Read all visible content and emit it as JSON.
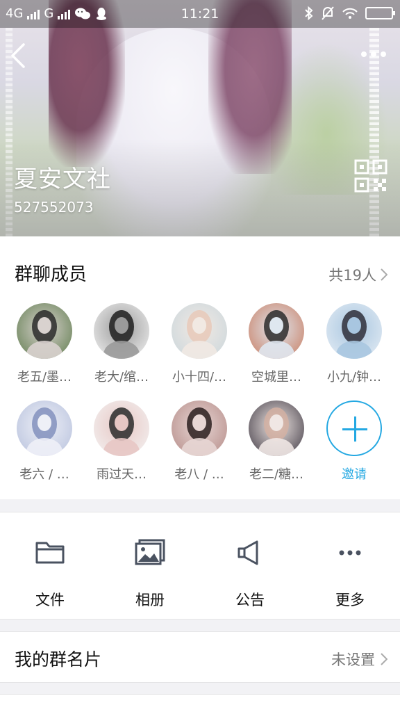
{
  "status_bar": {
    "network_1": "4G",
    "network_2": "G",
    "time": "11:21"
  },
  "header": {
    "group_name": "夏安文社",
    "group_id": "527552073"
  },
  "members": {
    "title": "群聊成员",
    "count_label": "共19人",
    "items": [
      {
        "label": "老五/墨…",
        "colors": [
          "#5c7a4a",
          "#2a2a2a",
          "#d9d2cf"
        ]
      },
      {
        "label": "老大/绾…",
        "colors": [
          "#f5f5f5",
          "#1d1d1d",
          "#9a9a9a"
        ]
      },
      {
        "label": "小十四/…",
        "colors": [
          "#c9d6dc",
          "#e8c9b8",
          "#f1e9e3"
        ]
      },
      {
        "label": "空城里…",
        "colors": [
          "#c87a5e",
          "#2b2b2b",
          "#dfe7ef"
        ]
      },
      {
        "label": "小九/钟…",
        "colors": [
          "#e7eef5",
          "#2f2f39",
          "#a8c6e0"
        ]
      },
      {
        "label": "老六 / …",
        "colors": [
          "#b6c0dc",
          "#8391bd",
          "#eef0f7"
        ]
      },
      {
        "label": "雨过天…",
        "colors": [
          "#f4f4f4",
          "#2a2a2a",
          "#e7c7c4"
        ]
      },
      {
        "label": "老八 / …",
        "colors": [
          "#b48a86",
          "#2a1f1f",
          "#e7d6d4"
        ]
      },
      {
        "label": "老二/糖…",
        "colors": [
          "#3b3540",
          "#d4b0a2",
          "#f0e7e4"
        ]
      }
    ],
    "invite_label": "邀请"
  },
  "tools": [
    {
      "label": "文件",
      "icon": "folder-icon"
    },
    {
      "label": "相册",
      "icon": "album-icon"
    },
    {
      "label": "公告",
      "icon": "megaphone-icon"
    },
    {
      "label": "更多",
      "icon": "more-dots-icon"
    }
  ],
  "card_row": {
    "title": "我的群名片",
    "value": "未设置"
  },
  "colors": {
    "accent": "#24a8e2",
    "icon_gray": "#4a5260"
  }
}
